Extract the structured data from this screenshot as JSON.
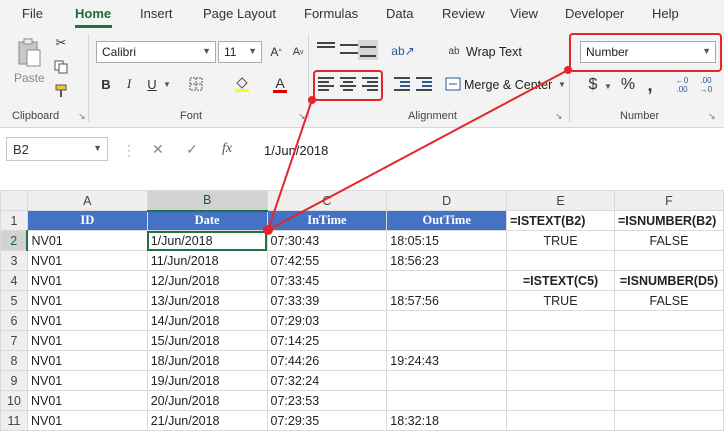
{
  "menu": {
    "items": [
      "File",
      "Home",
      "Insert",
      "Page Layout",
      "Formulas",
      "Data",
      "Review",
      "View",
      "Developer",
      "Help"
    ],
    "active": "Home"
  },
  "ribbon": {
    "clipboard": {
      "label": "Clipboard",
      "paste_label": "Paste"
    },
    "font": {
      "label": "Font",
      "font_name": "Calibri",
      "font_size": "11"
    },
    "alignment": {
      "label": "Alignment",
      "wrap_text": "Wrap Text",
      "merge_center": "Merge & Center"
    },
    "number": {
      "label": "Number",
      "format": "Number",
      "currency": "$",
      "percent": "%",
      "comma": ","
    }
  },
  "formula_bar": {
    "name_box": "B2",
    "fx": "fx",
    "value": "1/Jun/2018"
  },
  "columns": [
    "A",
    "B",
    "C",
    "D",
    "E",
    "F"
  ],
  "selected_column": "B",
  "selected_row": "2",
  "table_headers": [
    "ID",
    "Date",
    "InTime",
    "OutTime"
  ],
  "rows": [
    {
      "num": "2",
      "id": "NV01",
      "date": "1/Jun/2018",
      "intime": "07:30:43",
      "outtime": "18:05:15",
      "e": "TRUE",
      "f": "FALSE"
    },
    {
      "num": "3",
      "id": "NV01",
      "date": "11/Jun/2018",
      "intime": "07:42:55",
      "outtime": "18:56:23",
      "e": "",
      "f": ""
    },
    {
      "num": "4",
      "id": "NV01",
      "date": "12/Jun/2018",
      "intime": "07:33:45",
      "outtime": "",
      "e": "=ISTEXT(C5)",
      "f": "=ISNUMBER(D5)"
    },
    {
      "num": "5",
      "id": "NV01",
      "date": "13/Jun/2018",
      "intime": "07:33:39",
      "outtime": "18:57:56",
      "e": "TRUE",
      "f": "FALSE"
    },
    {
      "num": "6",
      "id": "NV01",
      "date": "14/Jun/2018",
      "intime": "07:29:03",
      "outtime": "",
      "e": "",
      "f": ""
    },
    {
      "num": "7",
      "id": "NV01",
      "date": "15/Jun/2018",
      "intime": "07:14:25",
      "outtime": "",
      "e": "",
      "f": ""
    },
    {
      "num": "8",
      "id": "NV01",
      "date": "18/Jun/2018",
      "intime": "07:44:26",
      "outtime": "19:24:43",
      "e": "",
      "f": ""
    },
    {
      "num": "9",
      "id": "NV01",
      "date": "19/Jun/2018",
      "intime": "07:32:24",
      "outtime": "",
      "e": "",
      "f": ""
    },
    {
      "num": "10",
      "id": "NV01",
      "date": "20/Jun/2018",
      "intime": "07:23:53",
      "outtime": "",
      "e": "",
      "f": ""
    },
    {
      "num": "11",
      "id": "NV01",
      "date": "21/Jun/2018",
      "intime": "07:29:35",
      "outtime": "18:32:18",
      "e": "",
      "f": ""
    }
  ],
  "row1": {
    "num": "1",
    "e": "=ISTEXT(B2)",
    "f": "=ISNUMBER(B2)"
  },
  "colors": {
    "header_fill": "#4472c4",
    "excel_green": "#217346",
    "annotation_red": "#e3262a"
  }
}
